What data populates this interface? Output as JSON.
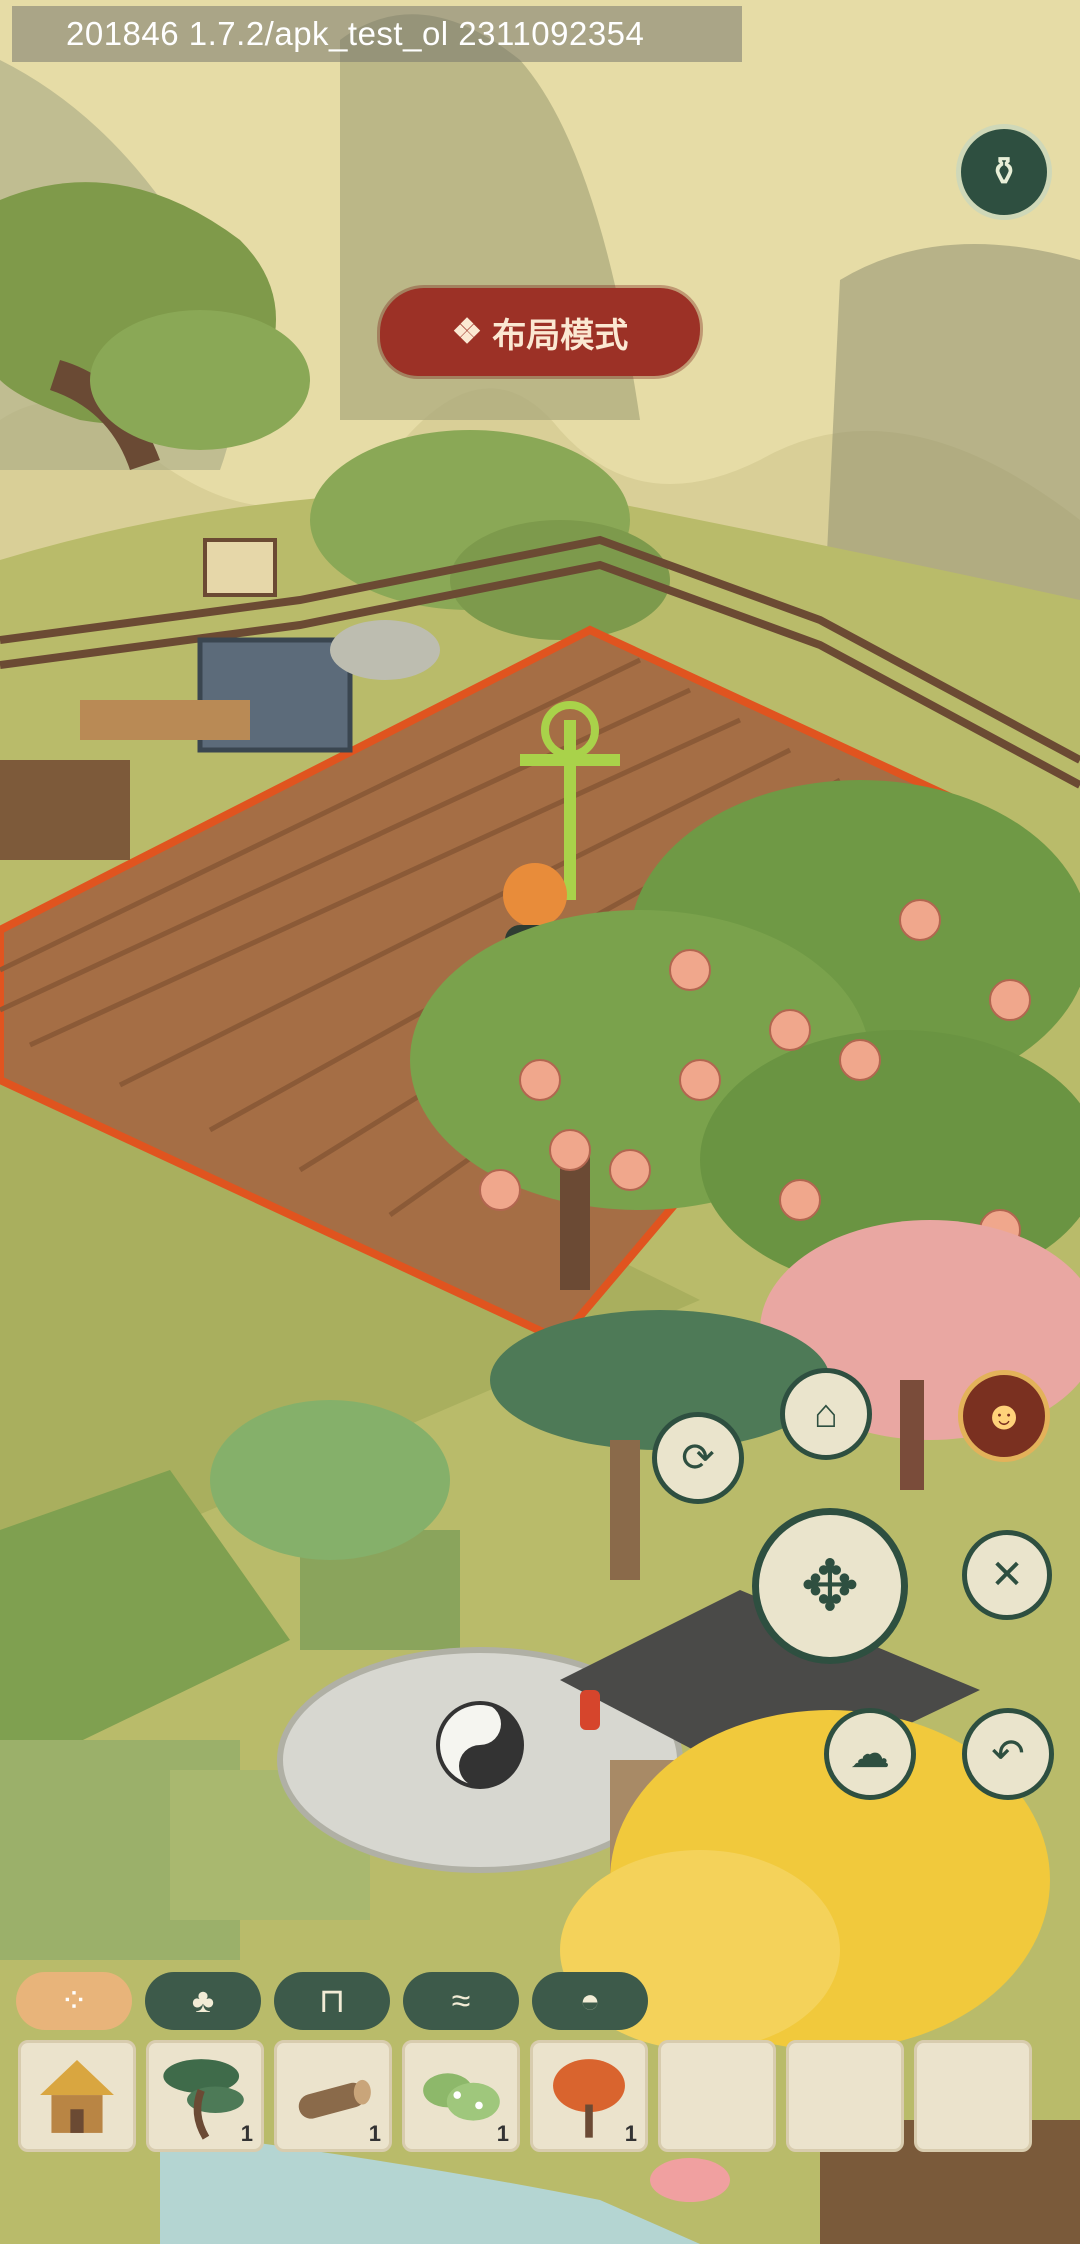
{
  "debug": {
    "build_text": "201846  1.7.2/apk_test_ol  2311092354"
  },
  "mode_banner": {
    "label": "布局模式",
    "icon": "diamond-grid-icon"
  },
  "controls": {
    "top_right": {
      "icon": "gourd-jar-icon"
    },
    "avatar": {
      "icon": "character-portrait-icon"
    },
    "rotate": {
      "icon": "rotate-arrows-icon"
    },
    "store": {
      "icon": "box-store-icon"
    },
    "move": {
      "icon": "four-arrows-move-icon"
    },
    "close": {
      "icon": "close-icon",
      "glyph": "✕"
    },
    "cloud": {
      "icon": "cloud-swirl-icon"
    },
    "undo": {
      "icon": "undo-arrow-icon",
      "glyph": "↶"
    }
  },
  "tabs": [
    {
      "icon": "four-dots-icon",
      "glyph": "⁘",
      "active": true
    },
    {
      "icon": "potted-plant-icon",
      "glyph": "♣",
      "active": false
    },
    {
      "icon": "table-icon",
      "glyph": "⊓",
      "active": false
    },
    {
      "icon": "scroll-icon",
      "glyph": "≈",
      "active": false
    },
    {
      "icon": "bowl-icon",
      "glyph": "◓",
      "active": false
    }
  ],
  "inventory": [
    {
      "item": "straw-hut",
      "count": ""
    },
    {
      "item": "pine-tree",
      "count": "1"
    },
    {
      "item": "log",
      "count": "1"
    },
    {
      "item": "leafy-shrub",
      "count": "1"
    },
    {
      "item": "autumn-tree",
      "count": "1"
    },
    {
      "item": "",
      "count": ""
    },
    {
      "item": "",
      "count": ""
    },
    {
      "item": "",
      "count": ""
    }
  ],
  "colors": {
    "banner_red": "#9c3126",
    "button_green": "#2e4f40",
    "tab_active": "#e8b47a",
    "field_orange": "#e0541f"
  }
}
